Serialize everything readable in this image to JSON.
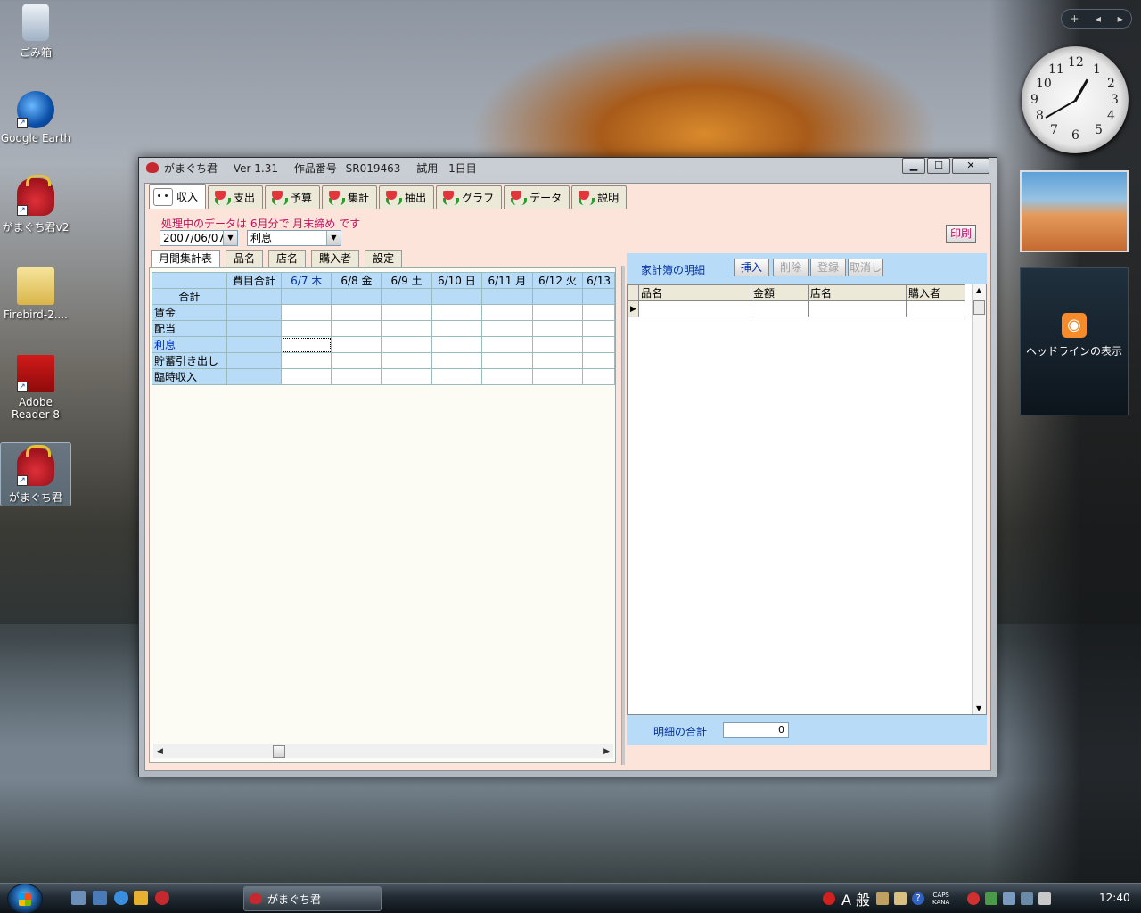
{
  "desktop": {
    "icons": [
      {
        "label": "ごみ箱"
      },
      {
        "label": "Google Earth"
      },
      {
        "label": "がまぐち君v2"
      },
      {
        "label": "Firebird-2...."
      },
      {
        "label": "Adobe Reader 8"
      },
      {
        "label": "がまぐち君"
      }
    ]
  },
  "gadgets": {
    "clock_numbers": [
      "12",
      "1",
      "2",
      "3",
      "4",
      "5",
      "6",
      "7",
      "8",
      "9",
      "10",
      "11"
    ],
    "rss_label": "ヘッドラインの表示"
  },
  "window": {
    "app_name": "がまぐち君",
    "version": "Ver 1.31",
    "serial_label": "作品番号",
    "serial": "SR019463",
    "trial": "試用",
    "day": "1日目",
    "buttons": {
      "minimize": "▁",
      "maximize": "☐",
      "close": "✕"
    }
  },
  "main_tabs": [
    {
      "label": "収入",
      "active": true
    },
    {
      "label": "支出"
    },
    {
      "label": "予算"
    },
    {
      "label": "集計"
    },
    {
      "label": "抽出"
    },
    {
      "label": "グラフ"
    },
    {
      "label": "データ"
    },
    {
      "label": "説明"
    }
  ],
  "status": "処理中のデータは 6月分で 月末締め です",
  "date_combo": "2007/06/07",
  "category_combo": "利息",
  "print_label": "印刷",
  "sub_tabs": [
    {
      "label": "月間集計表",
      "active": true
    },
    {
      "label": "品名"
    },
    {
      "label": "店名"
    },
    {
      "label": "購入者"
    },
    {
      "label": "設定"
    }
  ],
  "grid": {
    "header_sum": "費目合計",
    "columns": [
      "6/7 木",
      "6/8 金",
      "6/9 土",
      "6/10 日",
      "6/11 月",
      "6/12 火",
      "6/13"
    ],
    "total_row": "合計",
    "rows": [
      "賃金",
      "配当",
      "利息",
      "貯蓄引き出し",
      "臨時収入"
    ],
    "selected_row": "利息"
  },
  "detail": {
    "title": "家計簿の明細",
    "buttons": [
      {
        "label": "挿入",
        "enabled": true
      },
      {
        "label": "削除",
        "enabled": false
      },
      {
        "label": "登録",
        "enabled": false
      },
      {
        "label": "取消し",
        "enabled": false
      }
    ],
    "columns": [
      "品名",
      "金額",
      "店名",
      "購入者"
    ],
    "total_label": "明細の合計",
    "total_value": "0"
  },
  "taskbar": {
    "task_label": "がまぐち君",
    "ime": "A 般",
    "caps": "CAPS",
    "kana": "KANA",
    "time": "12:40"
  }
}
